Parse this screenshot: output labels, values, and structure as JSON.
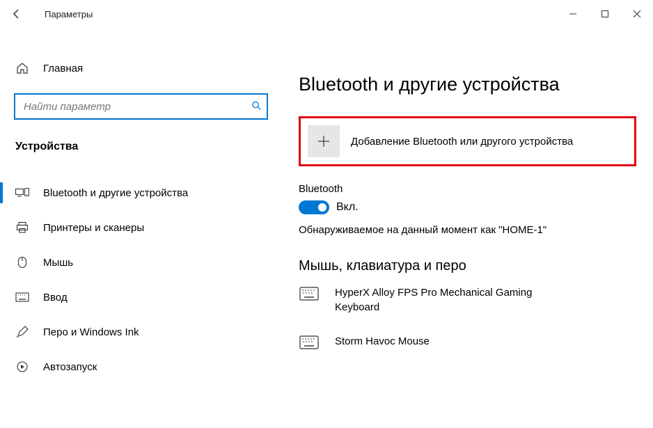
{
  "titlebar": {
    "title": "Параметры"
  },
  "sidebar": {
    "home": "Главная",
    "search_placeholder": "Найти параметр",
    "category": "Устройства",
    "items": [
      {
        "label": "Bluetooth и другие устройства",
        "active": true
      },
      {
        "label": "Принтеры и сканеры"
      },
      {
        "label": "Мышь"
      },
      {
        "label": "Ввод"
      },
      {
        "label": "Перо и Windows Ink"
      },
      {
        "label": "Автозапуск"
      }
    ]
  },
  "content": {
    "page_title": "Bluetooth и другие устройства",
    "add_device_label": "Добавление Bluetooth или другого устройства",
    "bluetooth_label": "Bluetooth",
    "toggle_state": "Вкл.",
    "discoverable_text": "Обнаруживаемое на данный момент как \"HOME-1\"",
    "devices_heading": "Мышь, клавиатура и перо",
    "devices": [
      {
        "name": "HyperX Alloy FPS Pro Mechanical Gaming Keyboard"
      },
      {
        "name": "Storm Havoc Mouse"
      }
    ]
  }
}
